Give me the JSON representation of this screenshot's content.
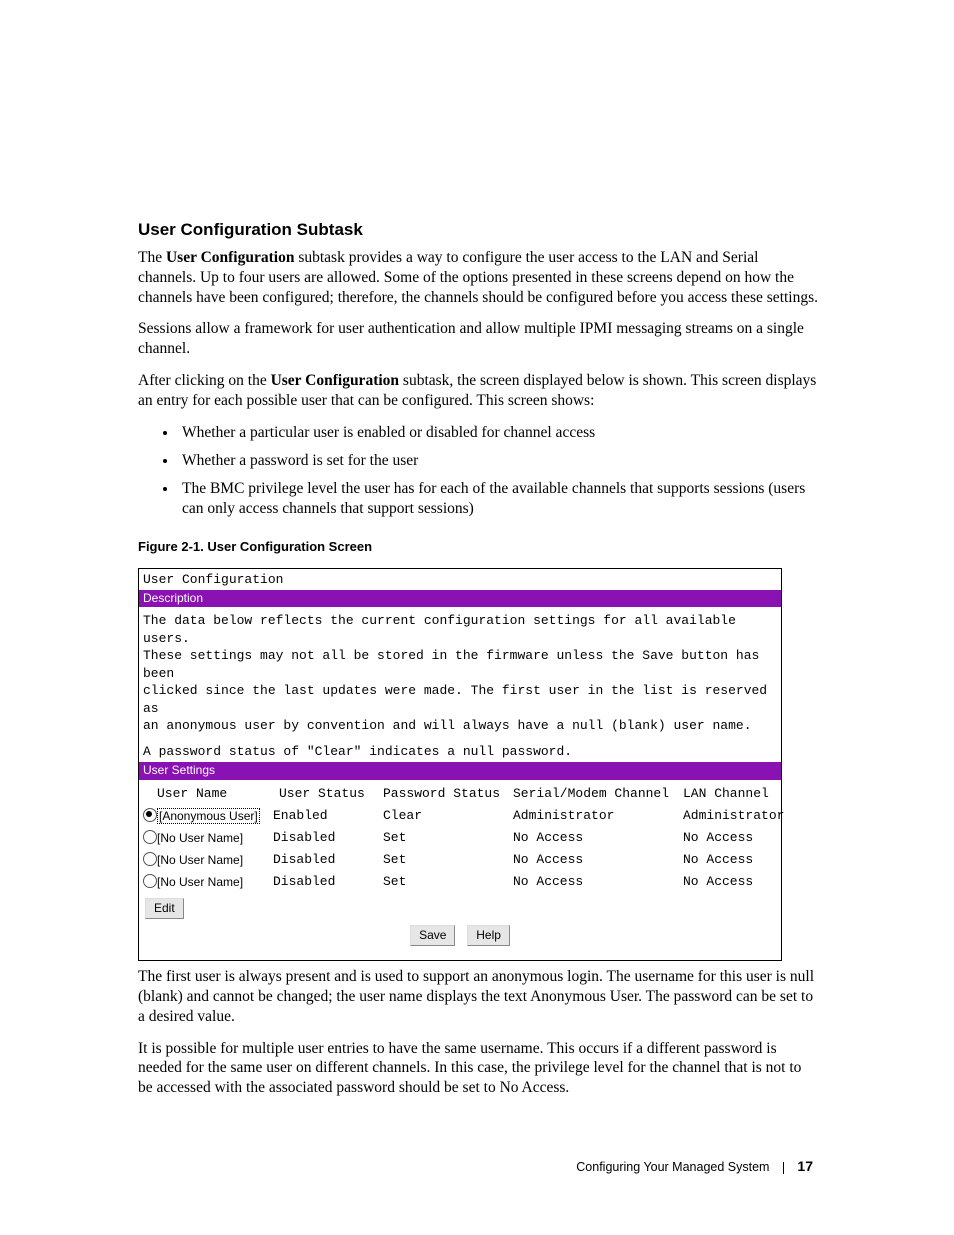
{
  "section_heading": "User Configuration Subtask",
  "para1_a": "The ",
  "para1_b": "User Configuration",
  "para1_c": " subtask provides a way to configure the user access to the LAN and Serial channels. Up to four users are allowed. Some of the options presented in these screens depend on how the channels have been configured; therefore, the channels should be configured before you access these settings.",
  "para2": "Sessions allow a framework for user authentication and allow multiple IPMI messaging streams on a single channel.",
  "para3_a": "After clicking on the ",
  "para3_b": "User Configuration",
  "para3_c": " subtask, the screen displayed below is shown. This screen displays an entry for each possible user that can be configured. This screen shows:",
  "bullets": [
    "Whether a particular user is enabled or disabled for channel access",
    "Whether a password is set for the user",
    "The BMC privilege level the user has for each of the available channels that supports sessions (users can only access channels that support sessions)"
  ],
  "figure_caption": "Figure 2-1.    User Configuration Screen",
  "screenshot": {
    "window_title": "User Configuration",
    "bar1": "Description",
    "desc_lines": [
      "The data below reflects the current configuration settings for all available users.",
      "These settings may not all be stored in the firmware unless the Save button has been",
      "clicked since the last updates were made.  The first user in the list is reserved as",
      "an anonymous user by convention and will always have a null (blank) user name."
    ],
    "desc_blank_then": "A password status of \"Clear\" indicates a null password.",
    "bar2": "User Settings",
    "headers": {
      "name": "User Name",
      "status": "User Status",
      "pw": "Password Status",
      "sm": "Serial/Modem Channel",
      "lan": "LAN Channel"
    },
    "rows": [
      {
        "selected": true,
        "name": "[Anonymous User]",
        "status": "Enabled",
        "pw": "Clear",
        "sm": "Administrator",
        "lan": "Administrator"
      },
      {
        "selected": false,
        "name": "[No User Name]",
        "status": "Disabled",
        "pw": "Set",
        "sm": "No Access",
        "lan": "No Access"
      },
      {
        "selected": false,
        "name": "[No User Name]",
        "status": "Disabled",
        "pw": "Set",
        "sm": "No Access",
        "lan": "No Access"
      },
      {
        "selected": false,
        "name": "[No User Name]",
        "status": "Disabled",
        "pw": "Set",
        "sm": "No Access",
        "lan": "No Access"
      }
    ],
    "edit_label": "Edit",
    "save_label": "Save",
    "help_label": "Help"
  },
  "para4": "The first user is always present and is used to support an anonymous login. The username for this user is null (blank) and cannot be changed; the user name displays the text Anonymous User. The password can be set to a desired value.",
  "para5": "It is possible for multiple user entries to have the same username. This occurs if a different password is needed for the same user on different channels. In this case, the privilege level for the channel that is not to be accessed with the associated password should be set to No Access.",
  "footer_text": "Configuring Your Managed System",
  "footer_page": "17"
}
